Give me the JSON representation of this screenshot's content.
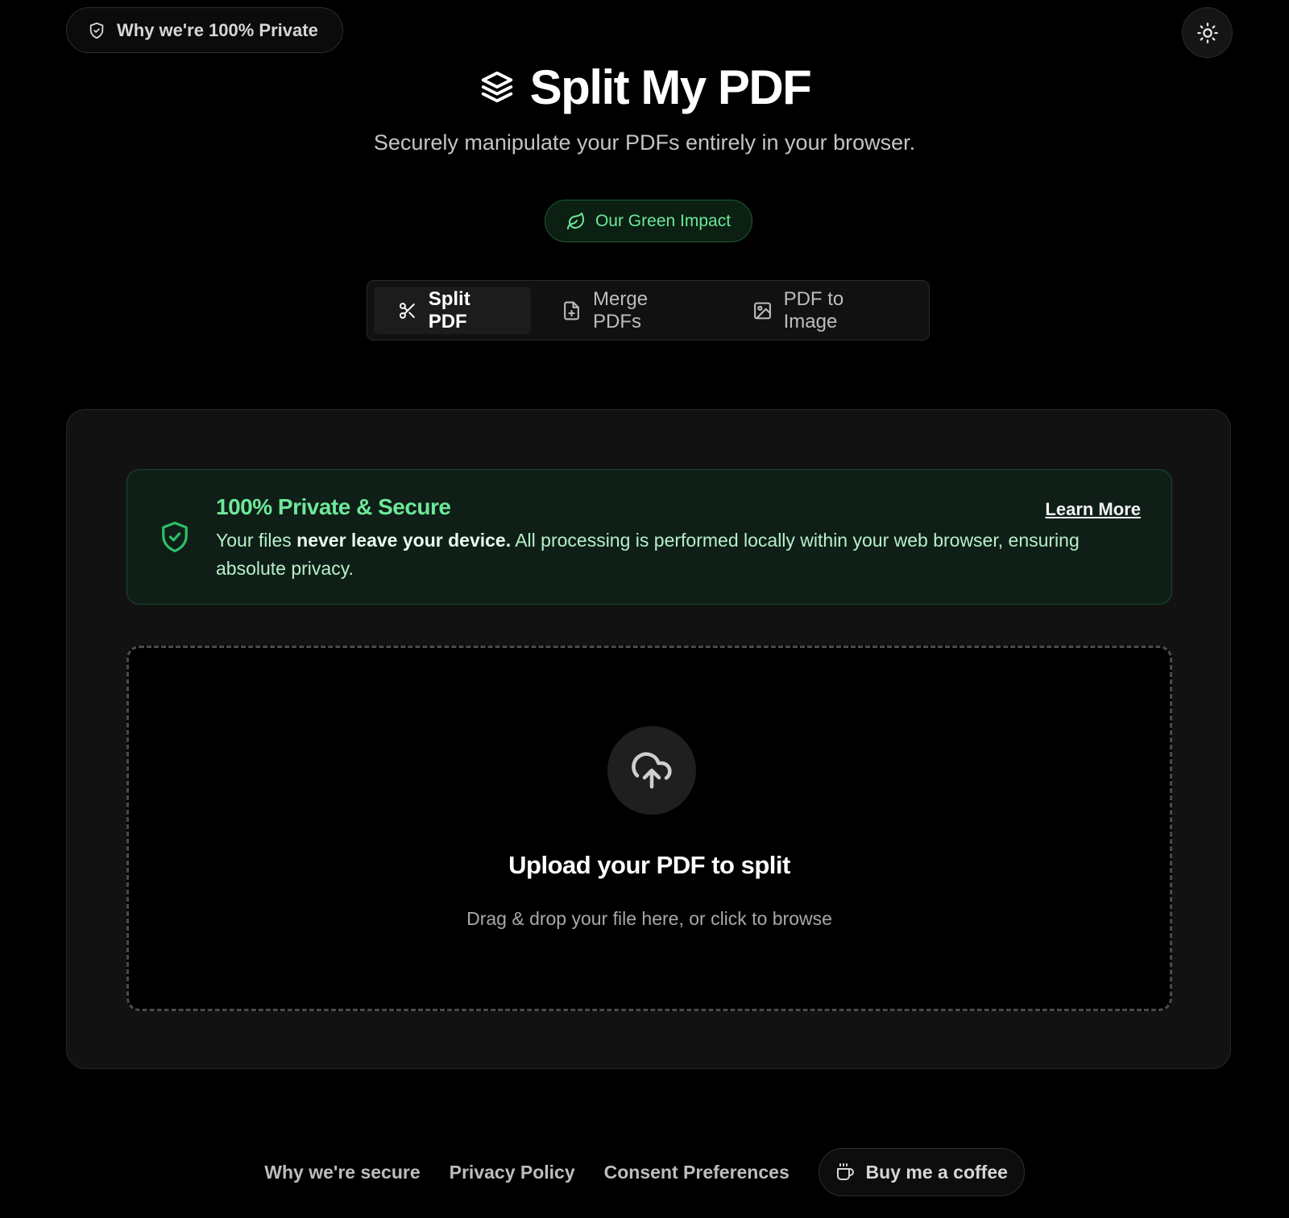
{
  "header": {
    "privacy_pill_label": "Why we're 100% Private",
    "title": "Split My PDF",
    "subtitle": "Securely manipulate your PDFs entirely in your browser.",
    "green_impact_label": "Our Green Impact"
  },
  "tabs": [
    {
      "label": "Split PDF",
      "icon": "scissors-icon",
      "active": true
    },
    {
      "label": "Merge PDFs",
      "icon": "file-plus-icon",
      "active": false
    },
    {
      "label": "PDF to Image",
      "icon": "image-icon",
      "active": false
    }
  ],
  "banner": {
    "title": "100% Private & Secure",
    "learn_more": "Learn More",
    "text_prefix": "Your files ",
    "text_bold": "never leave your device.",
    "text_suffix": " All processing is performed locally within your web browser, ensuring absolute privacy."
  },
  "dropzone": {
    "title": "Upload your PDF to split",
    "subtitle": "Drag & drop your file here, or click to browse"
  },
  "footer": {
    "links": [
      "Why we're secure",
      "Privacy Policy",
      "Consent Preferences"
    ],
    "coffee_label": "Buy me a coffee"
  },
  "colors": {
    "background": "#000000",
    "card": "#121212",
    "accent_green": "#6ee79a",
    "banner_bg": "#0f1f17"
  }
}
